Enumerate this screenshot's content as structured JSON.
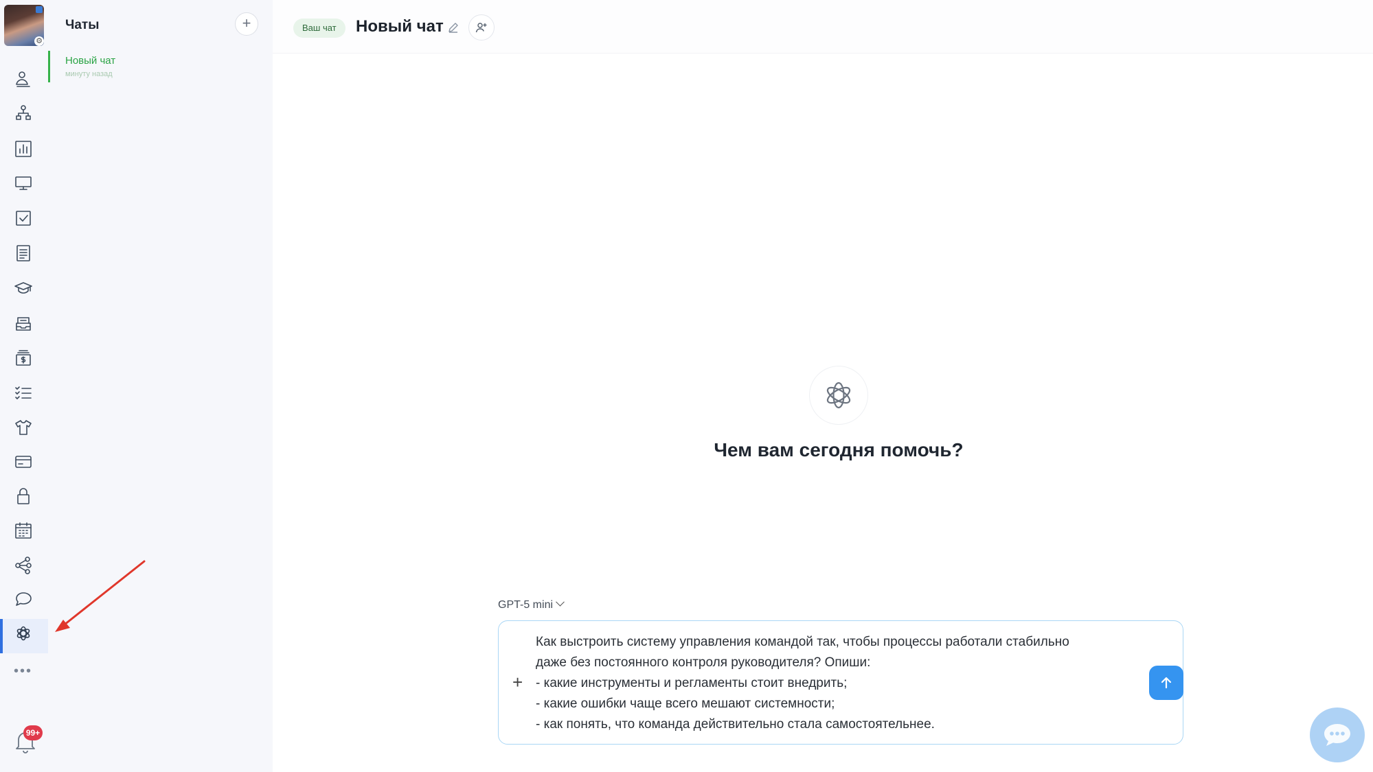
{
  "sidebar": {
    "notifications_badge": "99+",
    "more_label": "•••",
    "icons": [
      "users-icon",
      "org-structure-icon",
      "analytics-icon",
      "monitor-icon",
      "tasks-check-icon",
      "document-icon",
      "education-cap-icon",
      "inbox-tray-icon",
      "payments-icon",
      "checklist-icon",
      "shirt-icon",
      "card-icon",
      "lock-icon",
      "calendar-icon",
      "network-icon",
      "chat-bubble-icon",
      "openai-icon"
    ],
    "active_item": "openai-icon"
  },
  "chat_list": {
    "title": "Чаты",
    "add_label": "+",
    "items": [
      {
        "name": "Новый чат",
        "time": "минуту назад"
      }
    ]
  },
  "header": {
    "badge": "Ваш чат",
    "title": "Новый чат"
  },
  "main": {
    "greeting": "Чем вам сегодня помочь?"
  },
  "composer": {
    "model": "GPT-5 mini",
    "plus_label": "+",
    "message": "Как выстроить систему управления командой так, чтобы процессы работали стабильно\nдаже без постоянного контроля руководителя? Опиши:\n- какие инструменты и регламенты стоит внедрить;\n- какие ошибки чаще всего мешают системности;\n- как понять, что команда действительно стала самостоятельнее."
  },
  "colors": {
    "accent_blue": "#3594f0",
    "active_green": "#2aa344",
    "badge_red": "#e03a4b",
    "annotation_arrow": "#e0372b"
  }
}
